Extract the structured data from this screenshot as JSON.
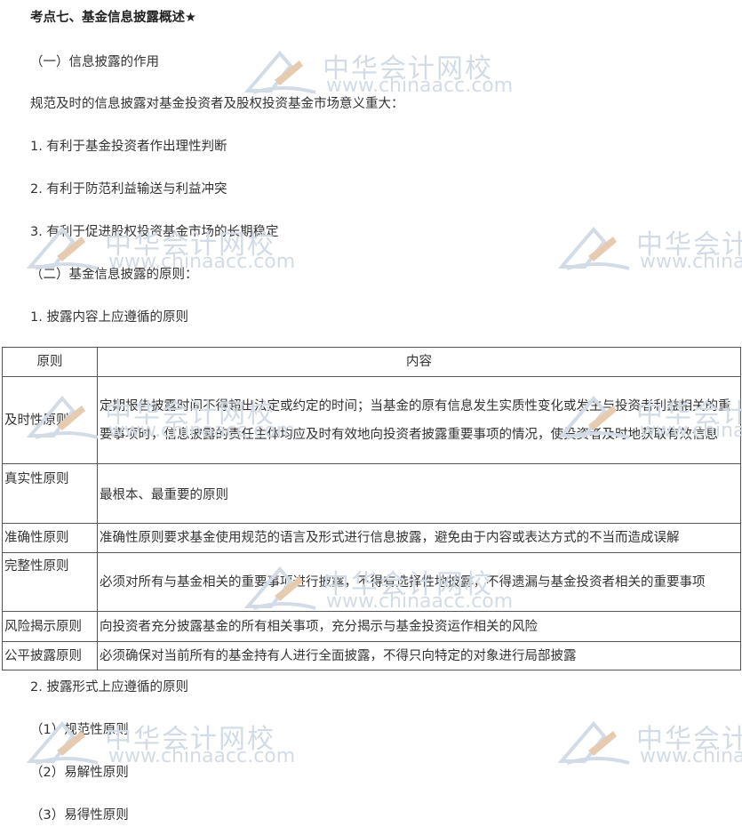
{
  "heading": "考点七、基金信息披露概述★",
  "sections": [
    "（一）信息披露的作用",
    "规范及时的信息披露对基金投资者及股权投资基金市场意义重大：",
    "1. 有利于基金投资者作出理性判断",
    "2. 有利于防范利益输送与利益冲突",
    "3. 有利于促进股权投资基金市场的长期稳定",
    "（二）基金信息披露的原则：",
    "1. 披露内容上应遵循的原则"
  ],
  "table": {
    "headers": [
      "原则",
      "内容"
    ],
    "rows": [
      {
        "principle": "及时性原则",
        "content": "定期报告披露时间不得超出法定或约定的时间；当基金的原有信息发生实质性变化或发生与投资者利益相关的重要事项时，信息披露的责任主体均应及时有效地向投资者披露重要事项的情况，使投资者及时地获取有效信息"
      },
      {
        "principle": "真实性原则",
        "content": "最根本、最重要的原则"
      },
      {
        "principle": "准确性原则",
        "content": "准确性原则要求基金使用规范的语言及形式进行信息披露，避免由于内容或表达方式的不当而造成误解"
      },
      {
        "principle": "完整性原则",
        "content": "必须对所有与基金相关的重要事项进行披露，不得有选择性地披露，不得遗漏与基金投资者相关的重要事项"
      },
      {
        "principle": "风险揭示原则",
        "content": "向投资者充分披露基金的所有相关事项，充分揭示与基金投资运作相关的风险"
      },
      {
        "principle": "公平披露原则",
        "content": "必须确保对当前所有的基金持有人进行全面披露，不得只向特定的对象进行局部披露"
      }
    ]
  },
  "after_table": [
    "2. 披露形式上应遵循的原则",
    "（1）规范性原则",
    "（2）易解性原则",
    "（3）易得性原则"
  ],
  "watermark": {
    "name": "中华会计网校",
    "url": "www.chinaacc.com",
    "icon": "pen-logo-icon",
    "color": "#d3dbe6"
  }
}
